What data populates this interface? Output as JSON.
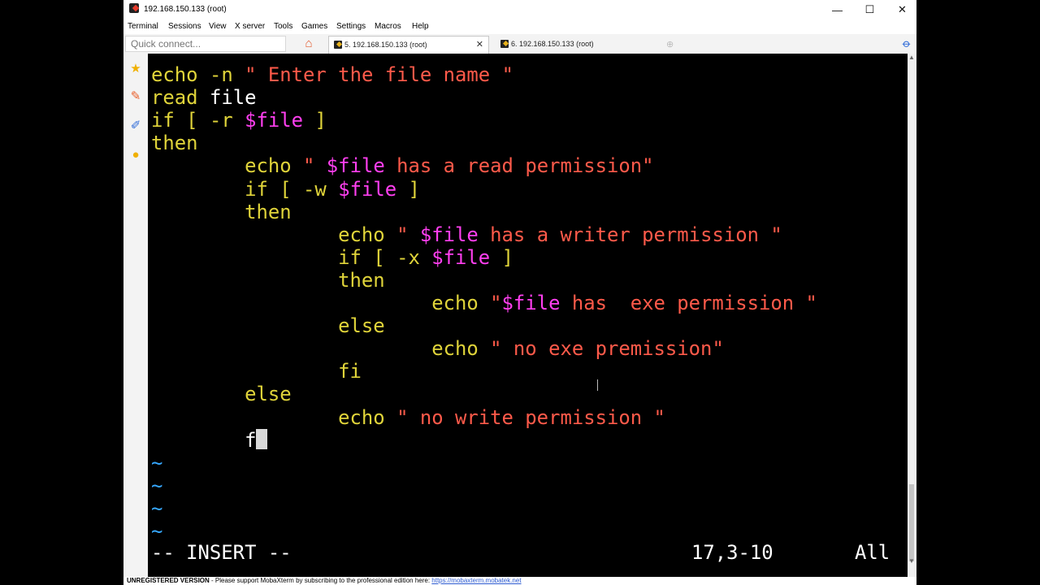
{
  "window": {
    "title": "192.168.150.133 (root)"
  },
  "window_controls": {
    "minimize": "—",
    "maximize": "☐",
    "close": "✕"
  },
  "menu": [
    "Terminal",
    "Sessions",
    "View",
    "X server",
    "Tools",
    "Games",
    "Settings",
    "Macros",
    "Help"
  ],
  "quick_connect": {
    "placeholder": "Quick connect..."
  },
  "tabs": [
    {
      "label": "5. 192.168.150.133 (root)",
      "active": true
    },
    {
      "label": "6. 192.168.150.133 (root)",
      "active": false
    }
  ],
  "terminal": {
    "lines": [
      [
        "echo -n \" Enter the file name \""
      ],
      [
        "read ",
        "file"
      ],
      [
        "if [ -r ",
        "$file",
        " ]"
      ],
      [
        "then"
      ],
      [
        "        echo \" ",
        "$file",
        " has a read permission\""
      ],
      [
        "        if [ -w ",
        "$file",
        " ]"
      ],
      [
        "        then"
      ],
      [
        "                echo \" ",
        "$file",
        " has a writer permission \""
      ],
      [
        "                if [ -x ",
        "$file",
        " ]"
      ],
      [
        "                then"
      ],
      [
        "                        echo \"",
        "$file",
        " has  exe permission \""
      ],
      [
        "                else"
      ],
      [
        "                        echo \" no exe premission\""
      ],
      [
        "                fi"
      ],
      [
        "        else"
      ],
      [
        "                echo \" no write permission \""
      ],
      [
        "        f"
      ]
    ],
    "tildes": [
      "~",
      "~",
      "~",
      "~"
    ],
    "mode": "-- INSERT --",
    "position": "17,3-10",
    "scroll": "All"
  },
  "footer": {
    "unregistered": "UNREGISTERED VERSION",
    "message": "  -  Please support MobaXterm by subscribing to the professional edition here: ",
    "link": "https://mobaxterm.mobatek.net"
  },
  "colors": {
    "keyword": "#e0d43a",
    "string": "#ff5a4a",
    "variable": "#ff3ff0",
    "tilde": "#36a8ff"
  }
}
